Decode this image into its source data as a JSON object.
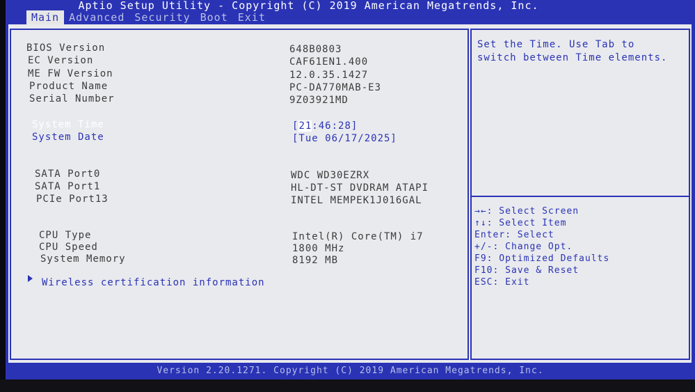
{
  "header": {
    "title": "Aptio Setup Utility - Copyright (C) 2019 American Megatrends, Inc.",
    "tabs": [
      {
        "label": "Main",
        "active": true
      },
      {
        "label": "Advanced",
        "active": false
      },
      {
        "label": "Security",
        "active": false
      },
      {
        "label": "Boot",
        "active": false
      },
      {
        "label": "Exit",
        "active": false
      }
    ]
  },
  "info": [
    {
      "label": "BIOS Version",
      "value": "648B0803"
    },
    {
      "label": "EC Version",
      "value": "CAF61EN1.400"
    },
    {
      "label": "ME FW Version",
      "value": "12.0.35.1427"
    },
    {
      "label": "Product Name",
      "value": "PC-DA770MAB-E3"
    },
    {
      "label": "Serial Number",
      "value": "9Z03921MD"
    }
  ],
  "system": {
    "time_label": "System Time",
    "time_cursor": "21",
    "time_rest": ":46:28]",
    "time_open": "[",
    "date_label": "System Date",
    "date_value": "[Tue 06/17/2025]"
  },
  "ports": [
    {
      "label": "SATA Port0",
      "value": "WDC WD30EZRX"
    },
    {
      "label": "SATA Port1",
      "value": "HL-DT-ST DVDRAM ATAPI"
    },
    {
      "label": "PCIe Port13",
      "value": "INTEL MEMPEK1J016GAL"
    }
  ],
  "cpu": [
    {
      "label": "CPU Type",
      "value": "Intel(R) Core(TM) i7"
    },
    {
      "label": "CPU Speed",
      "value": "1800 MHz"
    },
    {
      "label": "System Memory",
      "value": "8192 MB"
    }
  ],
  "submenu": {
    "label": "Wireless certification information"
  },
  "help": {
    "line1": "Set the Time. Use Tab to",
    "line2": "switch between Time elements."
  },
  "keys": [
    "→←: Select Screen",
    "↑↓: Select Item",
    "Enter: Select",
    "+/-: Change Opt.",
    "F9: Optimized Defaults",
    "F10: Save & Reset",
    "ESC: Exit"
  ],
  "footer": {
    "text": "Version 2.20.1271. Copyright (C) 2019 American Megatrends, Inc."
  },
  "colors": {
    "bios_blue": "#2a33b4",
    "panel_gray": "#e9eaee",
    "label_gray": "#3b3b3b"
  }
}
